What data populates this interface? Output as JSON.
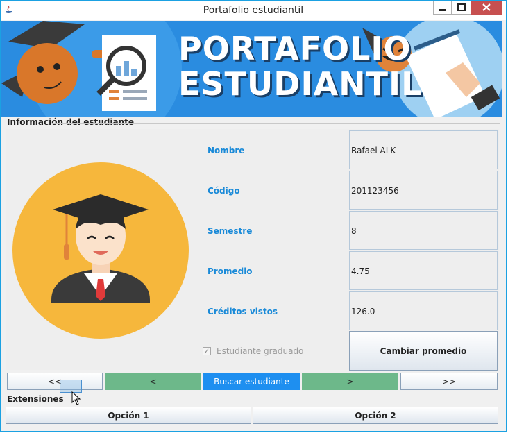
{
  "window": {
    "title": "Portafolio estudiantil",
    "controls": [
      "minimize-icon",
      "maximize-icon",
      "close-icon"
    ]
  },
  "banner": {
    "line1": "PORTAFOLIO",
    "line2": "ESTUDIANTIL"
  },
  "info": {
    "section_title": "Información del estudiante",
    "fields": [
      {
        "label": "Nombre",
        "value": "Rafael ALK"
      },
      {
        "label": "Código",
        "value": "201123456"
      },
      {
        "label": "Semestre",
        "value": "8"
      },
      {
        "label": "Promedio",
        "value": "4.75"
      },
      {
        "label": "Créditos vistos",
        "value": "126.0"
      }
    ],
    "graduated_label": "Estudiante graduado",
    "graduated_checked": true,
    "change_average_button": "Cambiar promedio"
  },
  "navigation": {
    "first": "<<",
    "previous": "<",
    "search": "Buscar estudiante",
    "next": ">",
    "last": ">>"
  },
  "extensions": {
    "section_title": "Extensiones",
    "option1": "Opción 1",
    "option2": "Opción 2"
  },
  "colors": {
    "label_blue": "#1a8ad8",
    "nav_green": "#6db88a",
    "search_blue": "#1e8ff0",
    "close_red": "#c75050",
    "banner_blue": "#2a8ce0",
    "avatar_orange": "#f6b73c"
  }
}
